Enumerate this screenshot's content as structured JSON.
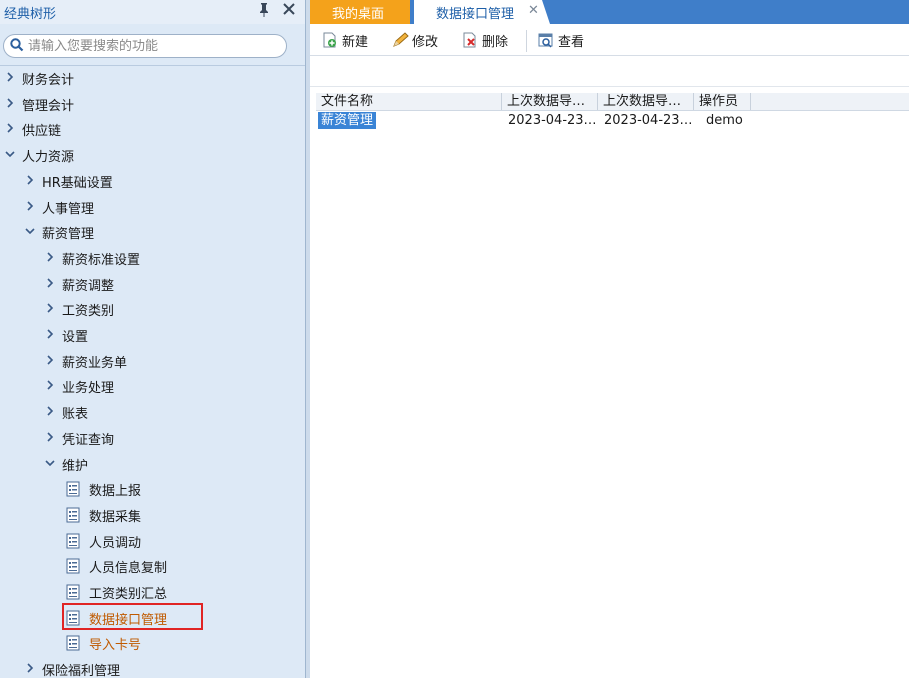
{
  "left_panel": {
    "title": "经典树形",
    "pin_icon": "pin-icon",
    "close_icon": "close-icon",
    "search": {
      "placeholder": "请输入您要搜索的功能",
      "value": ""
    },
    "tree": [
      {
        "label": "财务会计",
        "level": 0,
        "expanded": false
      },
      {
        "label": "管理会计",
        "level": 0,
        "expanded": false
      },
      {
        "label": "供应链",
        "level": 0,
        "expanded": false
      },
      {
        "label": "人力资源",
        "level": 0,
        "expanded": true
      },
      {
        "label": "HR基础设置",
        "level": 1,
        "expanded": false
      },
      {
        "label": "人事管理",
        "level": 1,
        "expanded": false
      },
      {
        "label": "薪资管理",
        "level": 1,
        "expanded": true
      },
      {
        "label": "薪资标准设置",
        "level": 2,
        "expanded": false
      },
      {
        "label": "薪资调整",
        "level": 2,
        "expanded": false
      },
      {
        "label": "工资类别",
        "level": 2,
        "expanded": false
      },
      {
        "label": "设置",
        "level": 2,
        "expanded": false
      },
      {
        "label": "薪资业务单",
        "level": 2,
        "expanded": false
      },
      {
        "label": "业务处理",
        "level": 2,
        "expanded": false
      },
      {
        "label": "账表",
        "level": 2,
        "expanded": false
      },
      {
        "label": "凭证查询",
        "level": 2,
        "expanded": false
      },
      {
        "label": "维护",
        "level": 2,
        "expanded": true
      },
      {
        "label": "数据上报",
        "level": 3,
        "leaf": true
      },
      {
        "label": "数据采集",
        "level": 3,
        "leaf": true
      },
      {
        "label": "人员调动",
        "level": 3,
        "leaf": true
      },
      {
        "label": "人员信息复制",
        "level": 3,
        "leaf": true
      },
      {
        "label": "工资类别汇总",
        "level": 3,
        "leaf": true
      },
      {
        "label": "数据接口管理",
        "level": 3,
        "leaf": true,
        "selected": true
      },
      {
        "label": "导入卡号",
        "level": 3,
        "leaf": true
      },
      {
        "label": "保险福利管理",
        "level": 1,
        "expanded": false
      }
    ]
  },
  "tabs": {
    "home_label": "我的桌面",
    "active_label": "数据接口管理",
    "close_glyph": "✕"
  },
  "toolbar": {
    "new_label": "新建",
    "edit_label": "修改",
    "delete_label": "删除",
    "view_label": "查看"
  },
  "grid": {
    "columns": [
      "文件名称",
      "上次数据导…",
      "上次数据导…",
      "操作员"
    ],
    "rows": [
      [
        "薪资管理",
        "2023-04-23…",
        "2023-04-23…",
        "demo"
      ]
    ]
  },
  "colors": {
    "accent": "#3f7ec9",
    "home_tab": "#f4a21b",
    "highlight": "#e02424",
    "selected_text": "#c05a00"
  }
}
